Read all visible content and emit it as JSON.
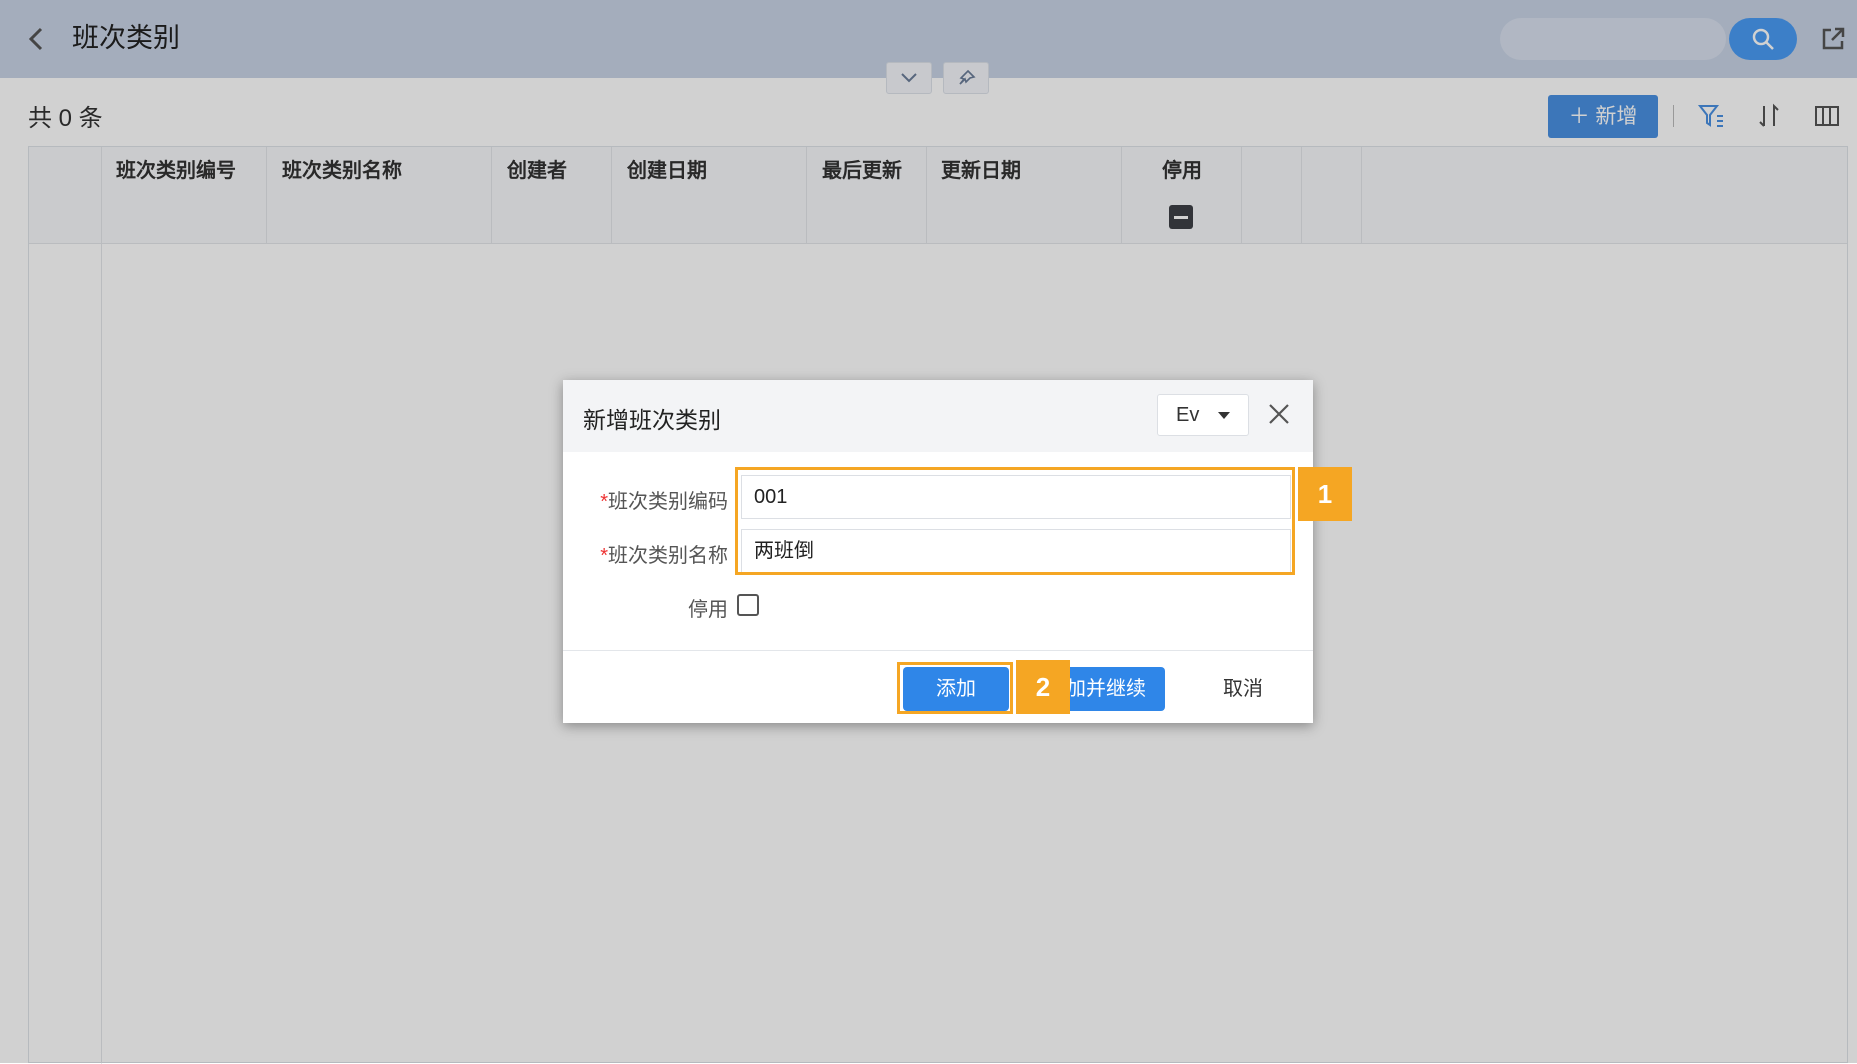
{
  "header": {
    "title": "班次类别"
  },
  "toolbar": {
    "record_count": "共 0 条",
    "add_button": "新增"
  },
  "grid": {
    "columns": [
      "班次类别编号",
      "班次类别名称",
      "创建者",
      "创建日期",
      "最后更新",
      "更新日期",
      "停用"
    ]
  },
  "dialog": {
    "title": "新增班次类别",
    "language": "Ev",
    "fields": {
      "code_label": "班次类别编码",
      "code_value": "001",
      "name_label": "班次类别名称",
      "name_value": "两班倒",
      "disabled_label": "停用"
    },
    "required_mark": "*",
    "buttons": {
      "add": "添加",
      "add_continue": "加并继续",
      "cancel": "取消"
    }
  },
  "annotations": {
    "step1": "1",
    "step2": "2"
  },
  "colors": {
    "accent": "#2f86e8",
    "highlight": "#f5a623"
  }
}
